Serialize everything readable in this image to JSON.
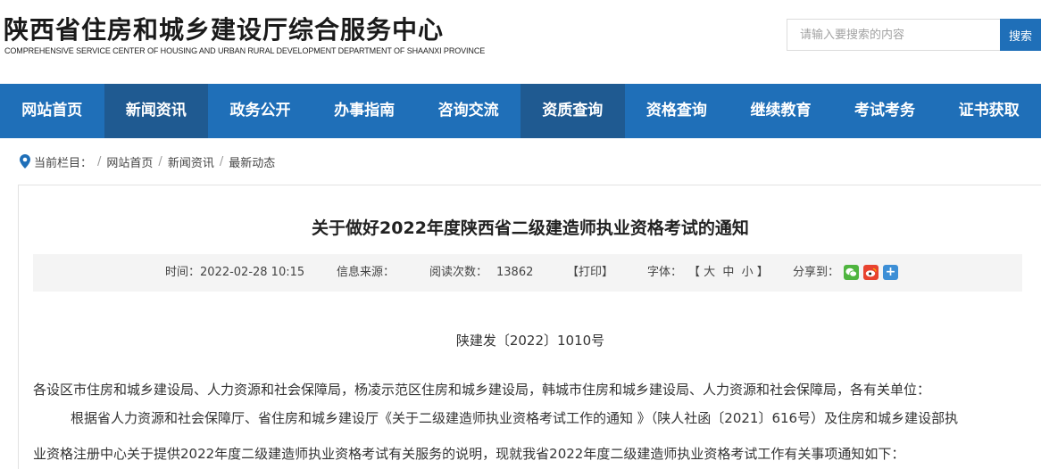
{
  "header": {
    "title": "陕西省住房和城乡建设厅综合服务中心",
    "subtitle": "COMPREHENSIVE SERVICE CENTER OF HOUSING AND URBAN RURAL DEVELOPMENT DEPARTMENT OF SHAANXI PROVINCE",
    "search_placeholder": "请输入要搜索的内容",
    "search_button": "搜索"
  },
  "nav": {
    "items": [
      {
        "label": "网站首页"
      },
      {
        "label": "新闻资讯"
      },
      {
        "label": "政务公开"
      },
      {
        "label": "办事指南"
      },
      {
        "label": "咨询交流"
      },
      {
        "label": "资质查询"
      },
      {
        "label": "资格查询"
      },
      {
        "label": "继续教育"
      },
      {
        "label": "考试考务"
      },
      {
        "label": "证书获取"
      }
    ]
  },
  "breadcrumb": {
    "prefix": "当前栏目：",
    "items": [
      "网站首页",
      "新闻资讯",
      "最新动态"
    ]
  },
  "article": {
    "title": "关于做好2022年度陕西省二级建造师执业资格考试的通知",
    "meta": {
      "time": "时间：2022-02-28 10:15",
      "source": "信息来源：",
      "views_label": "阅读次数：",
      "views": "13862",
      "print": "【打印】",
      "font_label": "字体：",
      "font_sizes": "【 大  中  小 】",
      "share_label": "分享到："
    },
    "doc_number": "陕建发〔2022〕1010号",
    "paragraphs": [
      "各设区市住房和城乡建设局、人力资源和社会保障局，杨凌示范区住房和城乡建设局，韩城市住房和城乡建设局、人力资源和社会保障局，各有关单位：",
      "根据省人力资源和社会保障厅、省住房和城乡建设厅《关于二级建造师执业资格考试工作的通知 》（陕人社函〔2021〕616号）及住房和城乡建设部执",
      "业资格注册中心关于提供2022年度二级建造师执业资格考试有关服务的说明，现就我省2022年度二级建造师执业资格考试工作有关事项通知如下："
    ]
  },
  "colors": {
    "nav_bg": "#1f6fb8",
    "nav_active_bg": "#1f5a91",
    "search_button_bg": "#1f6fb8"
  }
}
